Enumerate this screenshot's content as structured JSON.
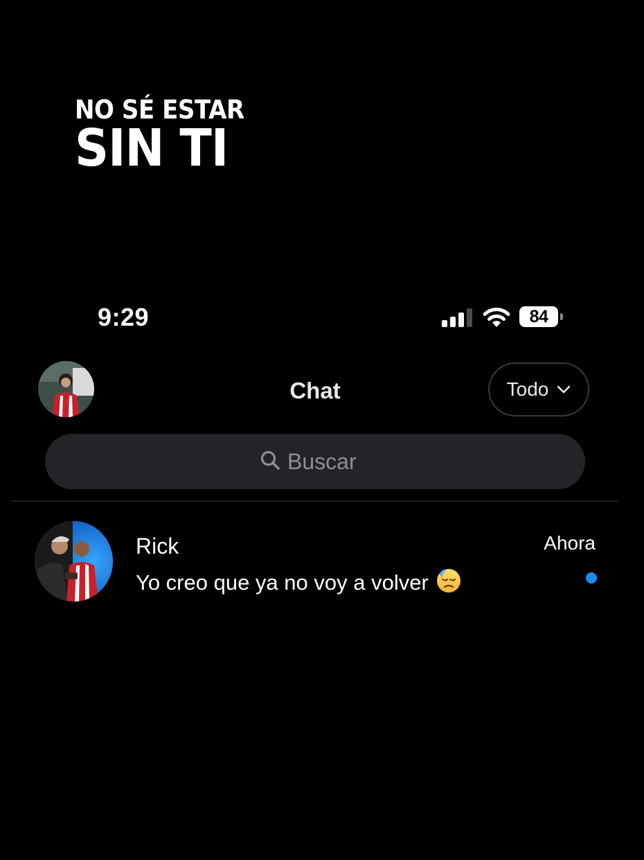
{
  "overlay": {
    "line1": "NO SÉ ESTAR",
    "line2": "SIN TI"
  },
  "status_bar": {
    "time": "9:29",
    "signal_icon": "cellular-signal-icon",
    "wifi_icon": "wifi-icon",
    "battery_level": "84"
  },
  "header": {
    "title": "Chat",
    "profile_avatar_icon": "profile-avatar",
    "filter": {
      "label": "Todo",
      "icon": "chevron-down-icon"
    }
  },
  "search": {
    "placeholder": "Buscar",
    "value": "",
    "icon": "search-icon"
  },
  "chats": [
    {
      "name": "Rick",
      "message": "Yo creo que ya no voy a volver",
      "emoji": "😓",
      "time": "Ahora",
      "unread": true
    }
  ],
  "colors": {
    "background": "#000000",
    "search_bg": "#242428",
    "unread_dot": "#1d8cf0",
    "muted_text": "#8e8e93"
  }
}
